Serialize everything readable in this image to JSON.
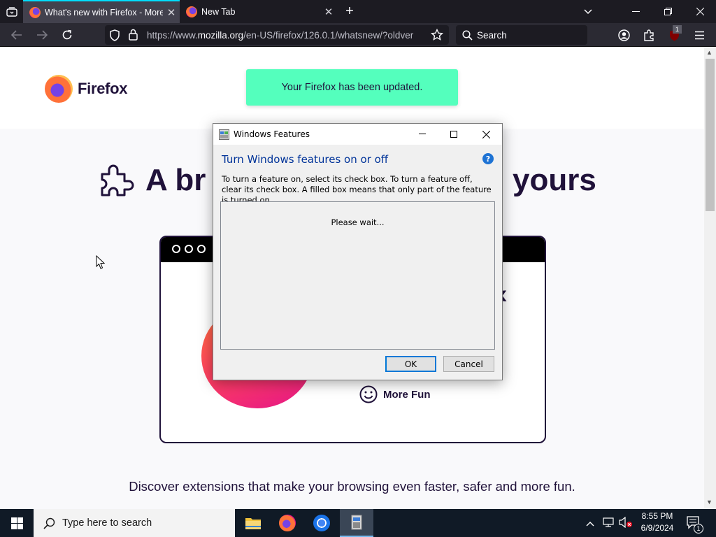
{
  "browser": {
    "tabs": [
      {
        "title": "What's new with Firefox - More",
        "active": true
      },
      {
        "title": "New Tab",
        "active": false
      }
    ],
    "url": "https://www.mozilla.org/en-US/firefox/126.0.1/whatsnew/?oldversion",
    "url_domain": "mozilla.org",
    "url_prefix": "https://www.",
    "url_suffix": "/en-US/firefox/126.0.1/whatsnew/?oldver",
    "search_placeholder": "Search",
    "extension_badge": "1"
  },
  "page": {
    "logo_text": "Firefox",
    "notification": "Your Firefox has been updated.",
    "heading_left": "A br",
    "heading_right": "yours",
    "more_fun": "More Fun",
    "discover_text": "Discover extensions that make your browsing even faster, safer and more fun."
  },
  "dialog": {
    "title": "Windows Features",
    "heading": "Turn Windows features on or off",
    "description": "To turn a feature on, select its check box. To turn a feature off, clear its check box. A filled box means that only part of the feature is turned on.",
    "list_status": "Please wait...",
    "ok_label": "OK",
    "cancel_label": "Cancel"
  },
  "taskbar": {
    "search_placeholder": "Type here to search",
    "time": "8:55 PM",
    "date": "6/9/2024",
    "notification_count": "1"
  },
  "colors": {
    "notification_bg": "#54ffbd",
    "heading_text": "#20123a",
    "dialog_heading": "#003399",
    "tab_accent": "#00ddff"
  }
}
